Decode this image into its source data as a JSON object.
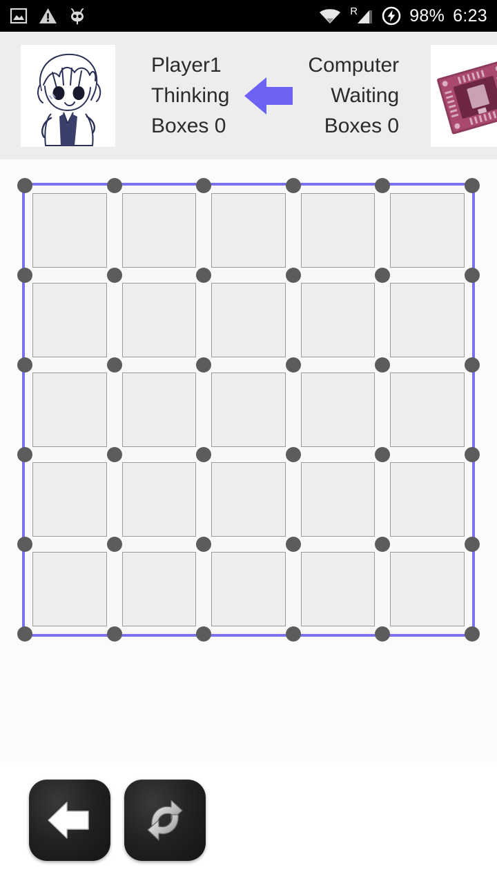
{
  "status_bar": {
    "left_icons": [
      "screenshot-image-icon",
      "warning-triangle-icon",
      "cyanogenmod-robot-icon"
    ],
    "right_icons": [
      "wifi-icon",
      "roaming-signal-icon",
      "charging-battery-icon"
    ],
    "roaming_label": "R",
    "battery_percent": "98%",
    "clock": "6:23"
  },
  "header": {
    "turn_arrow_direction": "left",
    "turn_arrow_color": "#6c63f5",
    "left_player": {
      "avatar": "anime-boy-avatar",
      "name": "Player1",
      "status": "Thinking",
      "boxes": "Boxes 0"
    },
    "right_player": {
      "avatar": "cpu-chip-avatar",
      "name": "Computer",
      "status": "Waiting",
      "boxes": "Boxes 0"
    }
  },
  "board": {
    "name": "dots-and-boxes-board",
    "rows": 5,
    "cols": 5,
    "dot_rows": 6,
    "dot_cols": 6,
    "border_color": "#7a72ee",
    "dot_color": "#5c5c5c",
    "cell_color": "#eeeeee",
    "drawn_lines": 0,
    "claimed_boxes": 0
  },
  "controls": {
    "back_label": "back-arrow-icon",
    "restart_label": "restart-refresh-icon"
  }
}
